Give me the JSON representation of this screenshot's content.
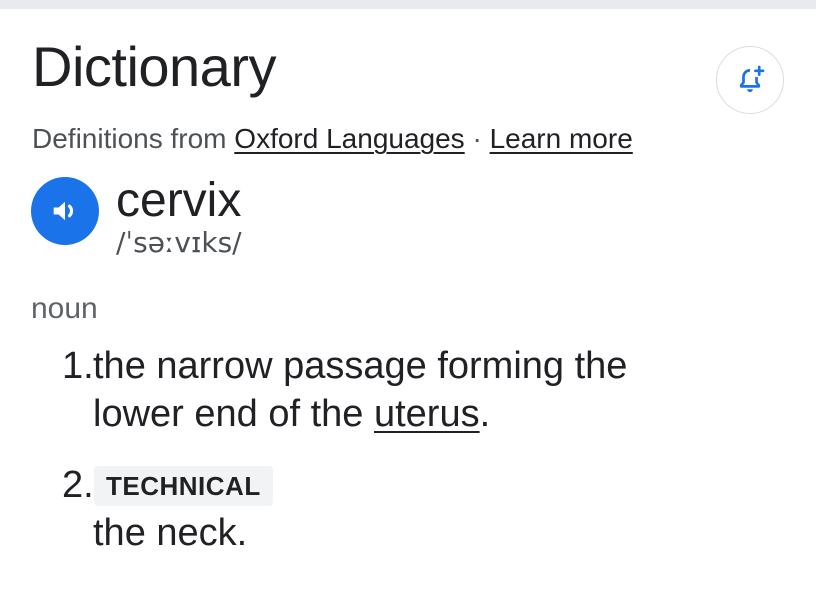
{
  "header": {
    "title": "Dictionary",
    "alert_button_icon": "add-alert-bell-icon"
  },
  "source": {
    "prefix": "Definitions from ",
    "provider_link": "Oxford Languages",
    "separator": " · ",
    "learn_more_link": "Learn more"
  },
  "entry": {
    "pronounce_icon": "speaker-icon",
    "word": "cervix",
    "phonetic": "/ˈsəːvɪks/",
    "part_of_speech": "noun",
    "definitions": [
      {
        "number": "1.",
        "line1": "the narrow passage forming the",
        "line2_before": "lower end of the ",
        "line2_link": "uterus",
        "line2_after": "."
      },
      {
        "number": "2.",
        "label": "TECHNICAL",
        "text": "the neck."
      }
    ]
  },
  "colors": {
    "accent_blue": "#1a73e8",
    "text_primary": "#202124",
    "text_secondary": "#4d5156",
    "badge_bg": "#f1f3f4"
  }
}
